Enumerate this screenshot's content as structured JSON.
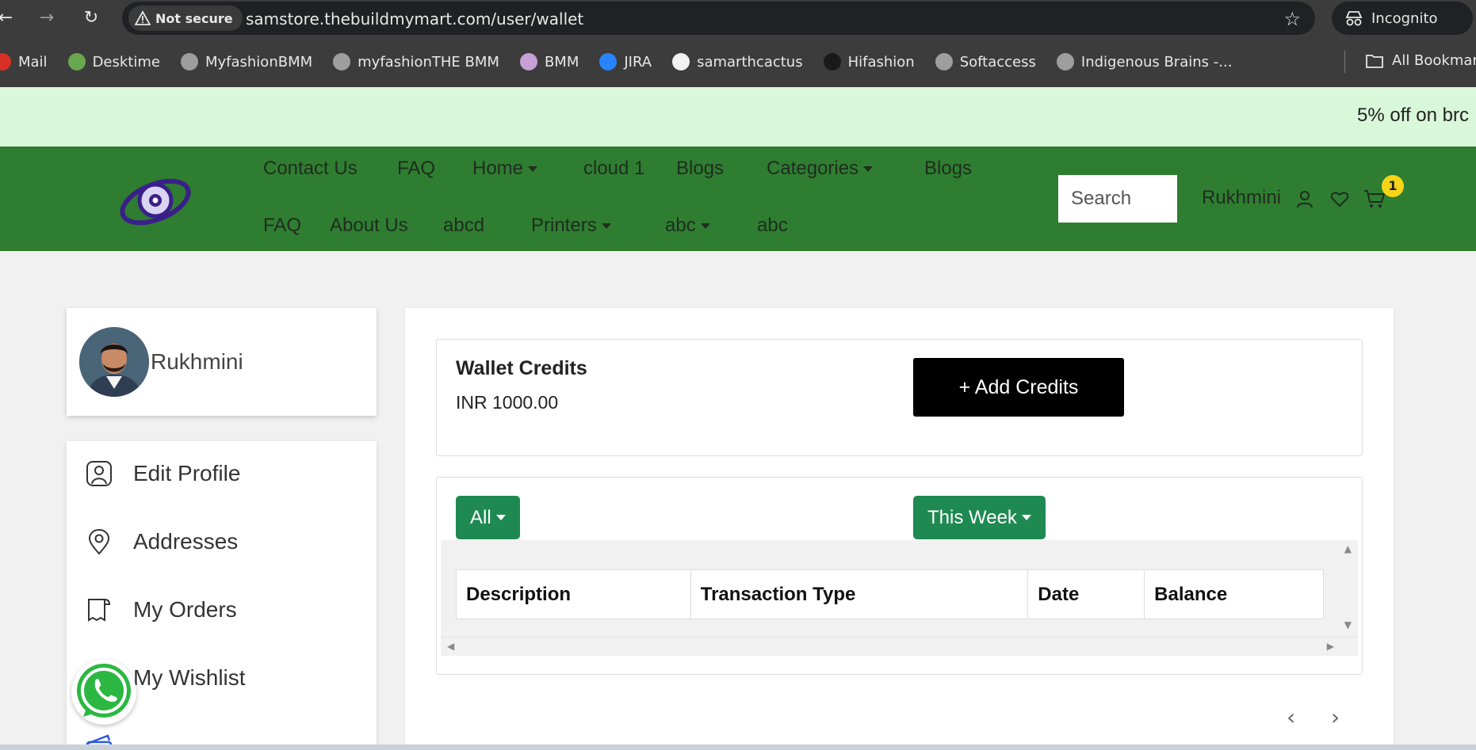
{
  "browser": {
    "security_label": "Not secure",
    "url": "samstore.thebuildmymart.com/user/wallet",
    "incognito_label": "Incognito",
    "bookmarks": [
      {
        "label": "Mail",
        "color": "#d93025"
      },
      {
        "label": "Desktime",
        "color": "#6aa84f"
      },
      {
        "label": "MyfashionBMM",
        "color": "#9e9e9e"
      },
      {
        "label": "myfashionTHE BMM",
        "color": "#9e9e9e"
      },
      {
        "label": "BMM",
        "color": "#c7a0d8"
      },
      {
        "label": "JIRA",
        "color": "#2684ff"
      },
      {
        "label": "samarthcactus",
        "color": "#f2f2f2"
      },
      {
        "label": "Hifashion",
        "color": "#1a1a1a"
      },
      {
        "label": "Softaccess",
        "color": "#9e9e9e"
      },
      {
        "label": "Indigenous Brains -...",
        "color": "#9e9e9e"
      }
    ],
    "all_bookmarks_label": "All Bookmarks"
  },
  "promo": {
    "text": "5% off on brc"
  },
  "header": {
    "menu_row1": [
      {
        "label": "Contact Us",
        "dropdown": false
      },
      {
        "label": "FAQ",
        "dropdown": false
      },
      {
        "label": "Home",
        "dropdown": true
      },
      {
        "label": "cloud 1",
        "dropdown": false
      },
      {
        "label": "Blogs",
        "dropdown": false
      },
      {
        "label": "Categories",
        "dropdown": true
      },
      {
        "label": "Blogs",
        "dropdown": false
      }
    ],
    "menu_row2": [
      {
        "label": "FAQ",
        "dropdown": false
      },
      {
        "label": "About Us",
        "dropdown": false
      },
      {
        "label": "abcd",
        "dropdown": false
      },
      {
        "label": "Printers",
        "dropdown": true
      },
      {
        "label": "abc",
        "dropdown": true
      },
      {
        "label": "abc",
        "dropdown": false
      }
    ],
    "search_placeholder": "Search",
    "user_name": "Rukhmini",
    "cart_count": "1"
  },
  "sidebar": {
    "profile_name": "Rukhmini",
    "items": [
      {
        "label": "Edit Profile",
        "icon": "user-square-icon"
      },
      {
        "label": "Addresses",
        "icon": "location-pin-icon"
      },
      {
        "label": "My Orders",
        "icon": "receipt-icon"
      },
      {
        "label": "My Wishlist",
        "icon": "heart-icon"
      }
    ]
  },
  "wallet": {
    "title": "Wallet Credits",
    "amount": "INR 1000.00",
    "add_label": "+ Add Credits"
  },
  "transactions": {
    "filter_type": "All",
    "filter_period": "This Week",
    "columns": [
      "Description",
      "Transaction Type",
      "Date",
      "Balance"
    ]
  },
  "pagination": {
    "prev": "‹",
    "next": "›"
  },
  "colors": {
    "header_green": "#2f7d31",
    "promo_bg": "#d9f7d9",
    "button_green": "#1e8a52",
    "cart_badge": "#f7d418"
  }
}
